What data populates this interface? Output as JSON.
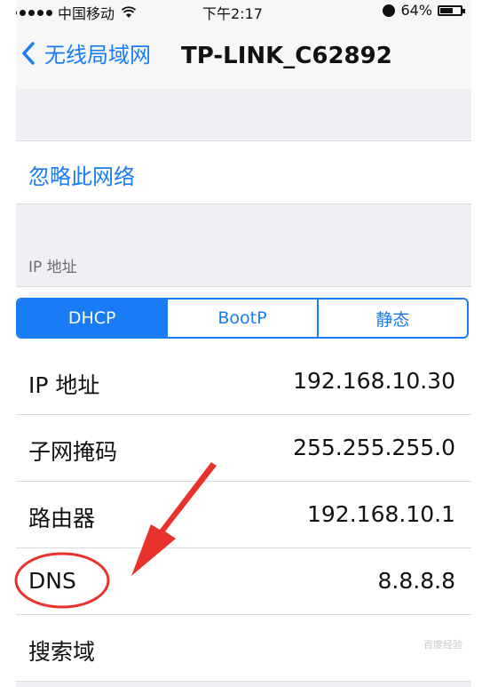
{
  "status_bar": {
    "carrier": "中国移动",
    "time": "下午2:17",
    "battery_percent": "64%",
    "battery_level": 0.64,
    "icons": [
      "signal-dots-icon",
      "wifi-icon",
      "alarm-icon",
      "battery-icon"
    ]
  },
  "nav": {
    "back_label": "无线局域网",
    "title": "TP-LINK_C62892"
  },
  "forget_network": "忽略此网络",
  "section_header": "IP 地址",
  "segmented": {
    "options": [
      "DHCP",
      "BootP",
      "静态"
    ],
    "selected": "DHCP"
  },
  "rows": [
    {
      "label": "IP 地址",
      "value": "192.168.10.30"
    },
    {
      "label": "子网掩码",
      "value": "255.255.255.0"
    },
    {
      "label": "路由器",
      "value": "192.168.10.1"
    },
    {
      "label": "DNS",
      "value": "8.8.8.8"
    },
    {
      "label": "搜索域",
      "value": ""
    }
  ],
  "colors": {
    "accent": "#1a7cf5",
    "annotation": "#e8322b",
    "background": "#efeff4"
  },
  "watermark": "百度经验"
}
